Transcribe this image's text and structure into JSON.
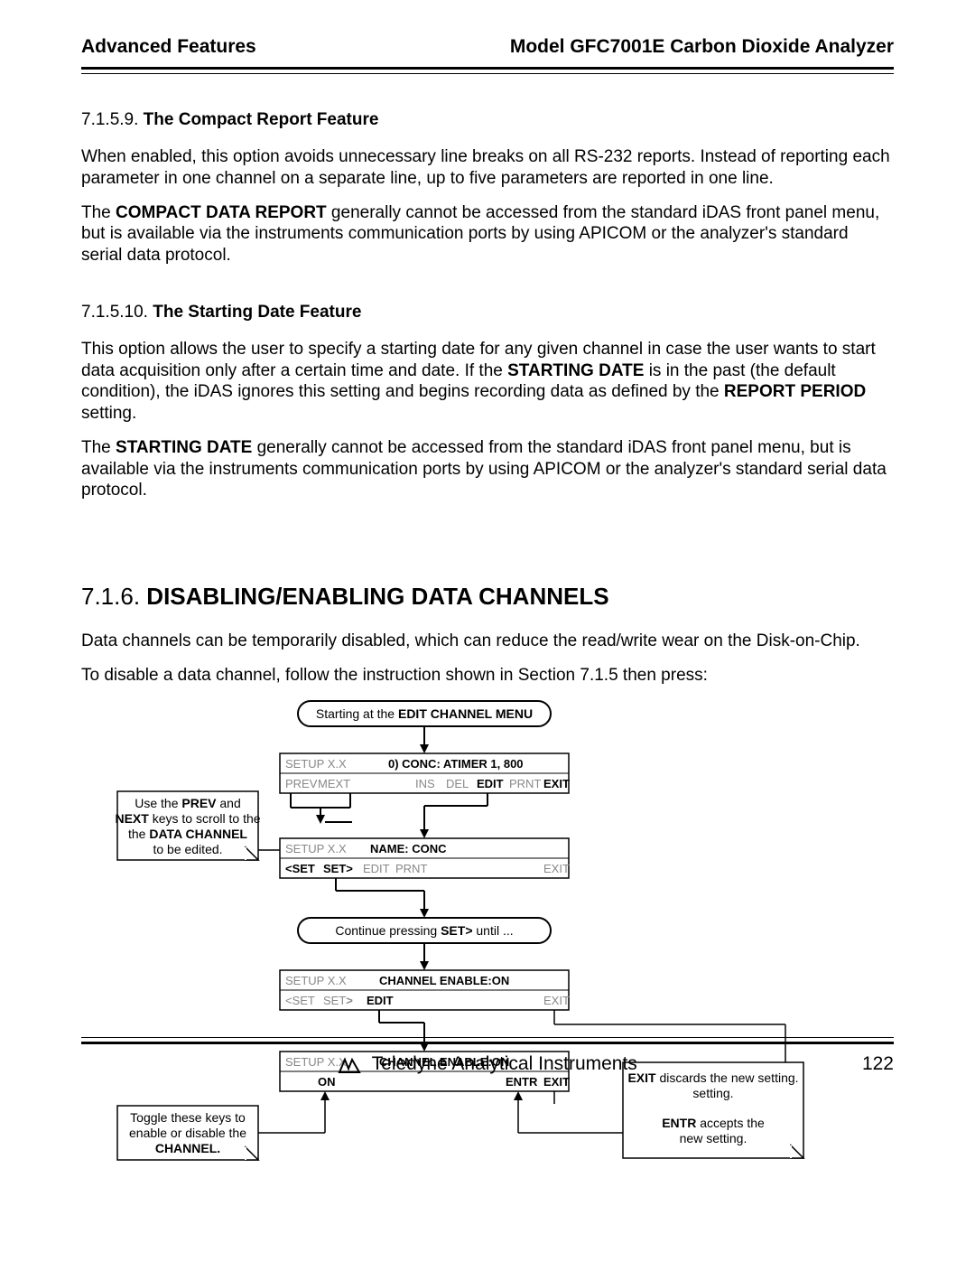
{
  "header": {
    "left": "Advanced Features",
    "right": "Model GFC7001E Carbon Dioxide Analyzer"
  },
  "sections": {
    "s1": {
      "num": "7.1.5.9.",
      "title": "The Compact Report Feature",
      "p1": "When enabled, this option avoids unnecessary line breaks on all RS-232 reports.  Instead of reporting each parameter in one channel on a separate line, up to five parameters are reported in one line.",
      "p2a": "The ",
      "p2b": "COMPACT DATA REPORT",
      "p2c": " generally cannot be accessed from the standard iDAS front panel menu, but is available via the instruments communication ports by using APICOM or the analyzer's standard serial data protocol."
    },
    "s2": {
      "num": "7.1.5.10.",
      "title": "The Starting Date Feature",
      "p1a": "This option allows the user to specify a starting date for any given channel in case the user wants to start data acquisition only after a certain time and date.  If the ",
      "p1b": "STARTING DATE",
      "p1c": " is in the past (the default condition), the iDAS ignores this setting and begins recording data as defined by the ",
      "p1d": "REPORT PERIOD",
      "p1e": " setting.",
      "p2a": "The ",
      "p2b": "STARTING DATE",
      "p2c": " generally cannot be accessed from the standard iDAS front panel menu, but is available via the instruments communication ports by using APICOM or the analyzer's standard serial data protocol."
    },
    "s3": {
      "num": "7.1.6.",
      "title": "DISABLING/ENABLING DATA CHANNELS",
      "p1": "Data channels can be temporarily disabled, which can reduce the read/write wear on the Disk-on-Chip.",
      "p2": "To disable a data channel, follow the instruction shown in Section 7.1.5 then press:"
    }
  },
  "flowchart": {
    "start_a": "Starting at the ",
    "start_b": "EDIT CHANNEL MENU",
    "note_left_top_a": "Use the ",
    "note_left_top_b": "PREV",
    "note_left_top_c": " and ",
    "note_left_top_d": "NEXT",
    "note_left_top_e": " keys to scroll to the ",
    "note_left_top_f": "DATA CHANNEL",
    "note_left_top_g": " to be edited.",
    "box1_setup": "SETUP X.X",
    "box1_conc": "0) CONC:  ATIMER 1, 800",
    "box1_keys_prev": "PREV",
    "box1_keys_mext": "MEXT",
    "box1_keys_ins": "INS",
    "box1_keys_del": "DEL",
    "box1_keys_edit": "EDIT",
    "box1_keys_prnt": "PRNT",
    "box1_keys_exit": "EXIT",
    "box2_setup": "SETUP X.X",
    "box2_name": "NAME: CONC",
    "box2_keys_set1": "<SET",
    "box2_keys_set2": "SET>",
    "box2_keys_edit": "EDIT",
    "box2_keys_prnt": "PRNT",
    "box2_keys_exit": "EXIT",
    "mid_round_a": "Continue pressing ",
    "mid_round_b": "SET>",
    "mid_round_c": " until ...",
    "box3_setup": "SETUP X.X",
    "box3_name": "CHANNEL ENABLE:ON",
    "box3_keys_set1": "<SET",
    "box3_keys_set2": "SET>",
    "box3_keys_edit": "EDIT",
    "box3_keys_exit": "EXIT",
    "box4_setup": "SETUP X.X",
    "box4_name": "CHANNEL ENABLE:ON",
    "box4_keys_on": "ON",
    "box4_keys_entr": "ENTR",
    "box4_keys_exit": "EXIT",
    "note_left_bot_a": "Toggle these keys to enable or disable the ",
    "note_left_bot_b": "CHANNEL.",
    "note_right_top_a": "EXIT",
    "note_right_top_b": " discards the new setting.",
    "note_right_bot_a": "ENTR",
    "note_right_bot_b": " accepts the new setting."
  },
  "footer": {
    "company": "Teledyne Analytical Instruments",
    "page": "122"
  }
}
